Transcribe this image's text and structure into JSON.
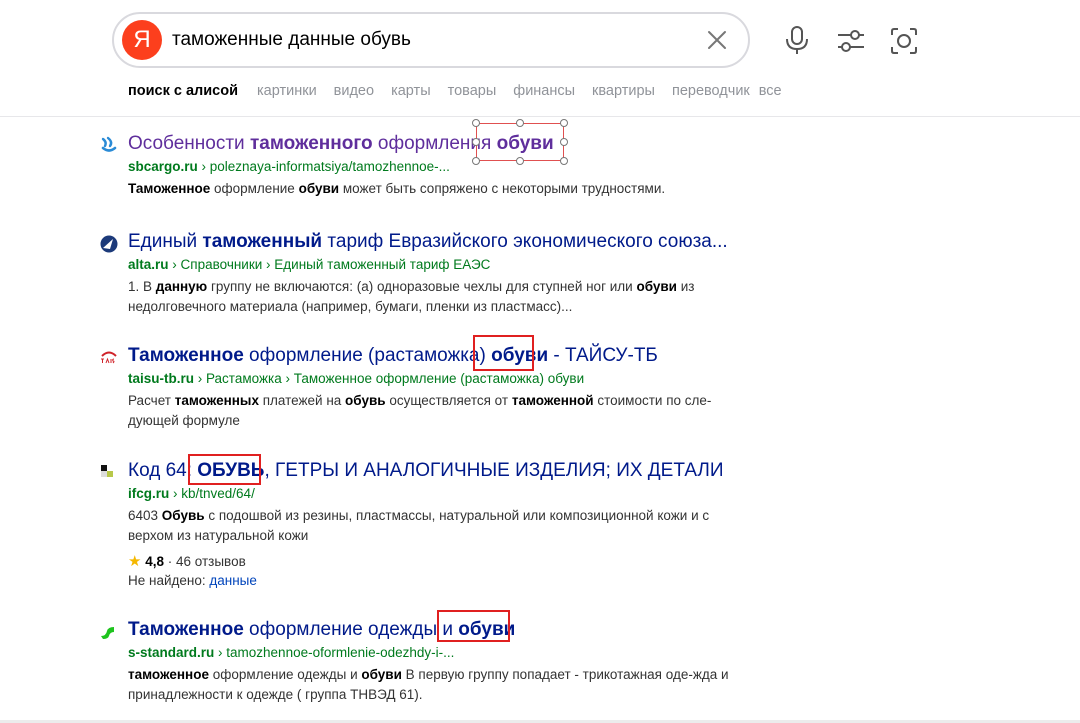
{
  "search": {
    "logo": "Я",
    "query": "таможенные данные обувь"
  },
  "tabs": [
    "поиск с алисой",
    "картинки",
    "видео",
    "карты",
    "товары",
    "финансы",
    "квартиры",
    "переводчик",
    "все"
  ],
  "results": [
    {
      "title": [
        [
          "Особенности ",
          false
        ],
        [
          "таможенного",
          true
        ],
        [
          " оформления ",
          false
        ],
        [
          "обуви",
          true
        ]
      ],
      "url": [
        [
          "sbcargo.ru",
          true
        ],
        [
          " › poleznaya-informatsiya/tamozhennoe-...",
          false
        ]
      ],
      "snippet": [
        [
          "Таможенное",
          true
        ],
        [
          " оформление ",
          false
        ],
        [
          "обуви",
          true
        ],
        [
          " может быть сопряжено с некоторыми трудностями.",
          false
        ]
      ]
    },
    {
      "title": [
        [
          "Единый ",
          false
        ],
        [
          "таможенный",
          true
        ],
        [
          " тариф Евразийского экономического союза...",
          false
        ]
      ],
      "url": [
        [
          "alta.ru",
          true
        ],
        [
          " › Справочники › Единый таможенный тариф ЕАЭС",
          false
        ]
      ],
      "snippet": [
        [
          "1. В ",
          false
        ],
        [
          "данную",
          true
        ],
        [
          " группу не включаются: (а) одноразовые чехлы для ступней ног или ",
          false
        ],
        [
          "обуви",
          true
        ],
        [
          " из недолговечного материала (например, бумаги, пленки из пластмасс)...",
          false
        ]
      ]
    },
    {
      "title": [
        [
          "Таможенное",
          true
        ],
        [
          " оформление (растаможка) ",
          false
        ],
        [
          "обуви",
          true
        ],
        [
          " - ТАЙСУ-ТБ",
          false
        ]
      ],
      "url": [
        [
          "taisu-tb.ru",
          true
        ],
        [
          " › Растаможка › Таможенное оформление (растаможка) обуви",
          false
        ]
      ],
      "snippet": [
        [
          "Расчет ",
          false
        ],
        [
          "таможенных",
          true
        ],
        [
          " платежей на ",
          false
        ],
        [
          "обувь",
          true
        ],
        [
          " осуществляется от ",
          false
        ],
        [
          "таможенной",
          true
        ],
        [
          " стоимости по сле-дующей формуле",
          false
        ]
      ]
    },
    {
      "title": [
        [
          "Код 64: ",
          false
        ],
        [
          "ОБУВЬ",
          true
        ],
        [
          ", ГЕТРЫ И АНАЛОГИЧНЫЕ ИЗДЕЛИЯ; ИХ ДЕТАЛИ",
          false
        ]
      ],
      "url": [
        [
          "ifcg.ru",
          true
        ],
        [
          " › kb/tnved/64/",
          false
        ]
      ],
      "snippet": [
        [
          "6403 ",
          false
        ],
        [
          "Обувь",
          true
        ],
        [
          " с подошвой из резины, пластмассы, натуральной или композиционной кожи и с верхом из натуральной кожи",
          false
        ]
      ],
      "rating_value": "4,8",
      "rating_reviews": " · 46 отзывов",
      "not_found_label": "Не найдено: ",
      "not_found_link": "данные"
    },
    {
      "title": [
        [
          "Таможенное",
          true
        ],
        [
          " оформление одежды и ",
          false
        ],
        [
          "обуви",
          true
        ]
      ],
      "url": [
        [
          "s-standard.ru",
          true
        ],
        [
          " › tamozhennoe-oformlenie-odezhdy-i-...",
          false
        ]
      ],
      "snippet": [
        [
          "таможенное",
          true
        ],
        [
          " оформление одежды и ",
          false
        ],
        [
          "обуви",
          true
        ],
        [
          " В первую группу попадает - трикотажная оде-жда и принадлежности к одежде ( группа ТНВЭД 61).",
          false
        ]
      ]
    }
  ],
  "colors": {
    "brand": "#fc3f1d",
    "link": "#001a8a",
    "visited": "#5f2e9c",
    "url": "#007a1d",
    "annotation": "#e02020"
  }
}
